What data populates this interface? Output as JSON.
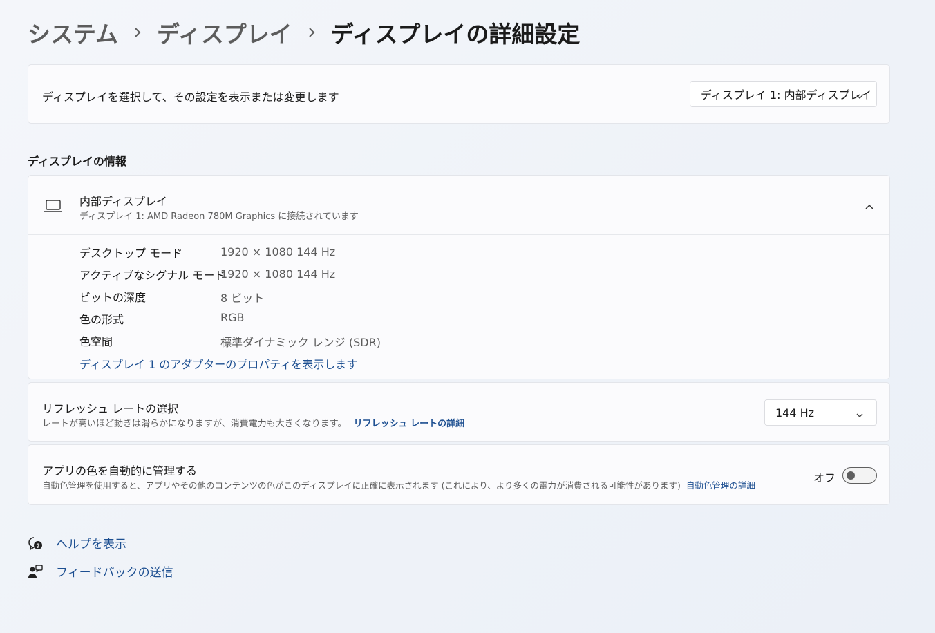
{
  "breadcrumb": {
    "items": [
      "システム",
      "ディスプレイ"
    ],
    "current": "ディスプレイの詳細設定"
  },
  "select_display": {
    "label": "ディスプレイを選択して、その設定を表示または変更します",
    "value": "ディスプレイ 1: 内部ディスプレイ"
  },
  "display_info": {
    "section_title": "ディスプレイの情報",
    "name": "内部ディスプレイ",
    "subtitle": "ディスプレイ 1: AMD Radeon 780M Graphics に接続されています",
    "specs": [
      {
        "key": "デスクトップ モード",
        "value": "1920 × 1080 144 Hz"
      },
      {
        "key": "アクティブなシグナル モード",
        "value": "1920 × 1080 144 Hz"
      },
      {
        "key": "ビットの深度",
        "value": "8 ビット"
      },
      {
        "key": "色の形式",
        "value": "RGB"
      },
      {
        "key": "色空間",
        "value": "標準ダイナミック レンジ (SDR)"
      }
    ],
    "adapter_link": "ディスプレイ 1 のアダプターのプロパティを表示します"
  },
  "refresh_rate": {
    "title": "リフレッシュ レートの選択",
    "description": "レートが高いほど動きは滑らかになりますが、消費電力も大きくなります。",
    "link": "リフレッシュ レートの詳細",
    "value": "144 Hz"
  },
  "auto_color": {
    "title": "アプリの色を自動的に管理する",
    "description": "自動色管理を使用すると、アプリやその他のコンテンツの色がこのディスプレイに正確に表示されます (これにより、より多くの電力が消費される可能性があります)",
    "link": "自動色管理の詳細",
    "toggle_label": "オフ",
    "toggle_on": false
  },
  "footer": {
    "help": "ヘルプを表示",
    "feedback": "フィードバックの送信"
  },
  "colors": {
    "accent_link": "#1d4f91",
    "card_bg": "#fbfbfd",
    "muted_text": "#5c5c5c"
  }
}
